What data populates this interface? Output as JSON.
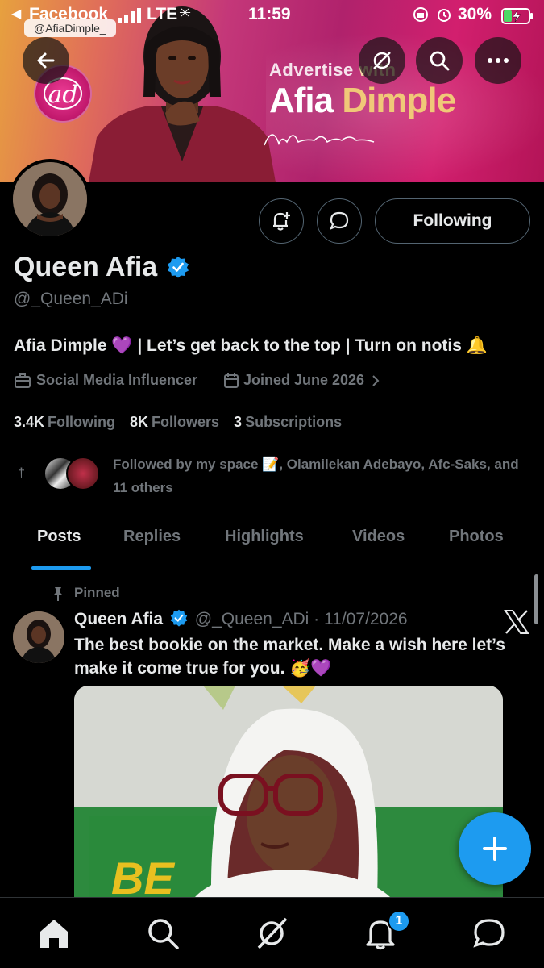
{
  "status_bar": {
    "back_glyph": "◀",
    "source_app": "Facebook",
    "network": "LTE",
    "time": "11:59",
    "battery": "30%"
  },
  "banner": {
    "instagram_handle": "@AfiaDimple_",
    "advertise_line_1": "Advertise ",
    "advertise_line_2": "with",
    "brand_first": "Afia ",
    "brand_second": "Dimple",
    "logo_text": "ad"
  },
  "profile": {
    "name": "Queen Afia",
    "handle": "@_Queen_ADi",
    "bio": "Afia Dimple 💜 | Let’s get back to the top | Turn on notis 🔔",
    "category": "Social Media Influencer",
    "joined": "Joined June 2026",
    "follow_button": "Following",
    "stats": {
      "following_count": "3.4K",
      "following_label": "Following",
      "followers_count": "8K",
      "followers_label": "Followers",
      "subscriptions_count": "3",
      "subscriptions_label": "Subscriptions"
    },
    "followed_by": "Followed by my space 📝, Olamilekan Adebayo, Afc-Saks, and 11 others"
  },
  "tabs": [
    "Posts",
    "Replies",
    "Highlights",
    "Videos",
    "Photos"
  ],
  "active_tab": "Posts",
  "post": {
    "pinned_label": "Pinned",
    "author_name": "Queen Afia",
    "author_handle": "@_Queen_ADi",
    "separator": " · ",
    "date": "11/07/2026",
    "text": "The best bookie on the market. Make a wish here let’s make it come true for you. 🥳💜",
    "image_sign_text": "BE"
  },
  "nav": {
    "notification_badge": "1"
  },
  "colors": {
    "accent": "#1d9bf0",
    "background": "#000000",
    "secondary_text": "#71767b",
    "primary_text": "#e7e9ea"
  },
  "icons": {
    "back": "back-arrow-icon",
    "grok": "grok-icon",
    "search": "search-icon",
    "more": "more-icon",
    "notify": "notification-add-icon",
    "message": "message-icon",
    "verified": "verified-badge-icon",
    "briefcase": "briefcase-icon",
    "calendar": "calendar-icon",
    "pin": "pin-icon",
    "x": "x-logo-icon",
    "compose": "plus-icon",
    "home": "home-icon",
    "bell": "bell-icon",
    "chat": "chat-icon"
  }
}
